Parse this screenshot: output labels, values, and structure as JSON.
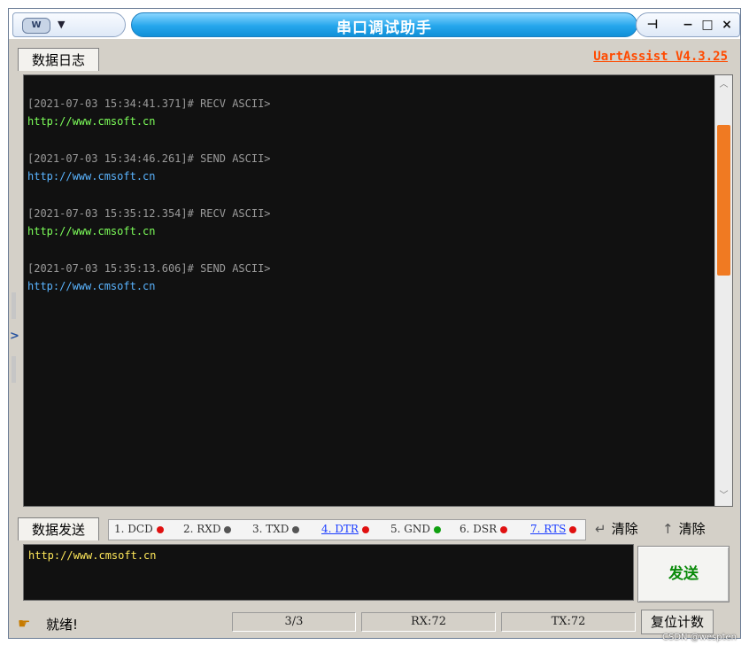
{
  "window": {
    "title": "串口调试助手",
    "icon_text": "W",
    "menu_caret": "▼",
    "pin": "⊣",
    "minimize": "−",
    "maximize": "□",
    "close": "×"
  },
  "tabs": {
    "log_tab": "数据日志",
    "brand": "UartAssist V4.3.25"
  },
  "log": {
    "entries": [
      {
        "header": "[2021-07-03 15:34:41.371]# RECV ASCII>",
        "body": "http://www.cmsoft.cn",
        "body_color": "#7dff5a"
      },
      {
        "header": "[2021-07-03 15:34:46.261]# SEND ASCII>",
        "body": "http://www.cmsoft.cn",
        "body_color": "#5ab4ff"
      },
      {
        "header": "[2021-07-03 15:35:12.354]# RECV ASCII>",
        "body": "http://www.cmsoft.cn",
        "body_color": "#7dff5a"
      },
      {
        "header": "[2021-07-03 15:35:13.606]# SEND ASCII>",
        "body": "http://www.cmsoft.cn",
        "body_color": "#5ab4ff"
      }
    ],
    "header_color": "#9a9a9a",
    "scroll_up": "︿",
    "scroll_down": "﹀",
    "accent_color": "#f07a22"
  },
  "send": {
    "tab_label": "数据发送",
    "pins": [
      {
        "label": "1. DCD",
        "color": "#e01010",
        "link": false
      },
      {
        "label": "2. RXD",
        "color": "#555555",
        "link": false
      },
      {
        "label": "3. TXD",
        "color": "#555555",
        "link": false
      },
      {
        "label": "4. DTR",
        "color": "#e01010",
        "link": true
      },
      {
        "label": "5. GND",
        "color": "#10a010",
        "link": false
      },
      {
        "label": "6. DSR",
        "color": "#e01010",
        "link": false
      },
      {
        "label": "7. RTS",
        "color": "#e01010",
        "link": true
      }
    ],
    "clear_receive": "清除",
    "clear_send": "清除",
    "input_value": "http://www.cmsoft.cn",
    "send_button": "发送"
  },
  "status": {
    "icon": "☛",
    "ready_text": "就绪!",
    "count": "3/3",
    "rx": "RX:72",
    "tx": "TX:72",
    "reset_button": "复位计数",
    "watermark": "CSDN @wespten"
  }
}
